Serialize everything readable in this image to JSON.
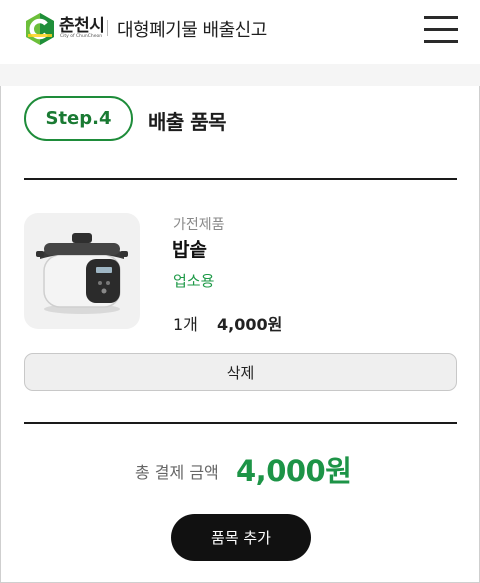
{
  "header": {
    "logo_name": "춘천시",
    "logo_sub": "City of ChunCheon",
    "service_title": "대형폐기물 배출신고",
    "menu_icon": "hamburger-menu-icon"
  },
  "step": {
    "label": "Step.4",
    "title": "배출 품목"
  },
  "item": {
    "image_icon": "pressure-rice-cooker-image",
    "category": "가전제품",
    "name": "밥솥",
    "use_type": "업소용",
    "quantity": "1개",
    "price": "4,000원",
    "delete_label": "삭제"
  },
  "total": {
    "label": "총 결제 금액",
    "amount": "4,000원"
  },
  "actions": {
    "add_item_label": "품목 추가"
  },
  "colors": {
    "accent_green": "#1d9447",
    "dark": "#111111"
  }
}
